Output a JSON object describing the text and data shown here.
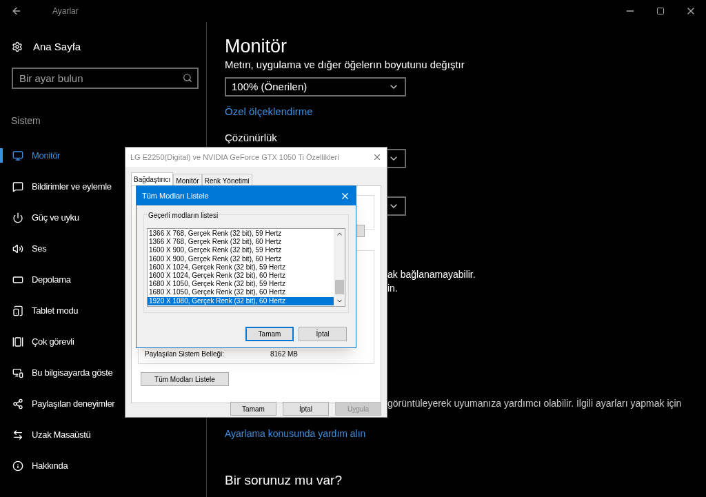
{
  "title_bar": {
    "title": "Ayarlar"
  },
  "sidebar": {
    "home": "Ana Sayfa",
    "search": {
      "placeholder": "Bir ayar bulun"
    },
    "section": "Sistem",
    "items": [
      {
        "label": "Monitör",
        "selected": true
      },
      {
        "label": "Bildirimler ve eylemle",
        "selected": false
      },
      {
        "label": "Güç ve uyku",
        "selected": false
      },
      {
        "label": "Ses",
        "selected": false
      },
      {
        "label": "Depolama",
        "selected": false
      },
      {
        "label": "Tablet modu",
        "selected": false
      },
      {
        "label": "Çok görevli",
        "selected": false
      },
      {
        "label": "Bu bilgisayarda göste",
        "selected": false
      },
      {
        "label": "Paylaşılan deneyimler",
        "selected": false
      },
      {
        "label": "Uzak Masaüstü",
        "selected": false
      },
      {
        "label": "Hakkında",
        "selected": false
      }
    ]
  },
  "main": {
    "heading": "Monitör",
    "scale_label": "Metın, uygulama ve dığer öğelerın boyutunu değıştır",
    "scale_value": "100% (Önerilen)",
    "custom_scaling_link": "Özel ölçeklendirme",
    "resolution_label": "Çözünürlük",
    "note_line_1": "ak bağlanamayabilir.",
    "note_line_2": "in.",
    "night_light_text": "görüntüleyerek uyumanıza yardımcı olabilir. İlgili ayarları yapmak için",
    "help_link": "Ayarlama konusunda yardım alın",
    "question_heading": "Bir sorunuz mu var?"
  },
  "properties_dialog": {
    "title": "LG E2250(Digital) ve NVIDIA GeForce GTX 1050 Ti Özellikleri",
    "tabs": [
      {
        "label": "Bağdaştırıcı",
        "selected": true
      },
      {
        "label": "Monitör",
        "selected": false
      },
      {
        "label": "Renk Yönetimi",
        "selected": false
      }
    ],
    "shared_memory_label": "Paylaşılan Sistem Belleği:",
    "shared_memory_value": "8162 MB",
    "list_all_button": "Tüm Modları Listele",
    "buttons": [
      {
        "label": "Tamam",
        "disabled": false
      },
      {
        "label": "İptal",
        "disabled": false
      },
      {
        "label": "Uygula",
        "disabled": true
      }
    ]
  },
  "modes_dialog": {
    "title": "Tüm Modları Listele",
    "group_label": "Geçerli modların listesi",
    "modes": [
      {
        "label": "1366 X 768, Gerçek Renk (32 bit), 59 Hertz",
        "selected": false
      },
      {
        "label": "1366 X 768, Gerçek Renk (32 bit), 60 Hertz",
        "selected": false
      },
      {
        "label": "1600 X 900, Gerçek Renk (32 bit), 59 Hertz",
        "selected": false
      },
      {
        "label": "1600 X 900, Gerçek Renk (32 bit), 60 Hertz",
        "selected": false
      },
      {
        "label": "1600 X 1024, Gerçek Renk (32 bit), 59 Hertz",
        "selected": false
      },
      {
        "label": "1600 X 1024, Gerçek Renk (32 bit), 60 Hertz",
        "selected": false
      },
      {
        "label": "1680 X 1050, Gerçek Renk (32 bit), 59 Hertz",
        "selected": false
      },
      {
        "label": "1680 X 1050, Gerçek Renk (32 bit), 60 Hertz",
        "selected": false
      },
      {
        "label": "1920 X 1080, Gerçek Renk (32 bit), 60 Hertz",
        "selected": true
      }
    ],
    "buttons": [
      {
        "label": "Tamam",
        "default": true
      },
      {
        "label": "İptal",
        "default": false
      }
    ]
  }
}
